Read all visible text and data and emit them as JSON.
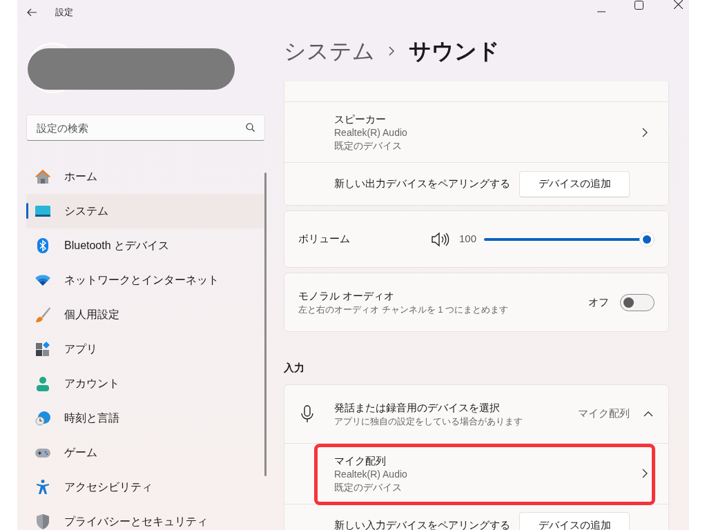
{
  "window": {
    "title": "設定"
  },
  "sidebar": {
    "search": {
      "placeholder": "設定の検索"
    },
    "items": [
      {
        "label": "ホーム",
        "kind": "home",
        "selected": false
      },
      {
        "label": "システム",
        "kind": "system",
        "selected": true
      },
      {
        "label": "Bluetooth とデバイス",
        "kind": "bluetooth",
        "selected": false
      },
      {
        "label": "ネットワークとインターネット",
        "kind": "wifi",
        "selected": false
      },
      {
        "label": "個人用設定",
        "kind": "brush",
        "selected": false
      },
      {
        "label": "アプリ",
        "kind": "apps",
        "selected": false
      },
      {
        "label": "アカウント",
        "kind": "account",
        "selected": false
      },
      {
        "label": "時刻と言語",
        "kind": "time",
        "selected": false
      },
      {
        "label": "ゲーム",
        "kind": "game",
        "selected": false
      },
      {
        "label": "アクセシビリティ",
        "kind": "accessibility",
        "selected": false
      },
      {
        "label": "プライバシーとセキュリティ",
        "kind": "shield",
        "selected": false
      }
    ]
  },
  "breadcrumb": [
    "システム",
    "サウンド"
  ],
  "output": {
    "devices": [
      {
        "name": "スピーカー",
        "driver": "Realtek(R) Audio",
        "status": "既定のデバイス"
      }
    ],
    "pair_label": "新しい出力デバイスをペアリングする",
    "pair_button": "デバイスの追加"
  },
  "volume": {
    "label": "ボリューム",
    "reading": "100",
    "level": 1.0
  },
  "mono_audio": {
    "title": "モノラル オーディオ",
    "description": "左と右のオーディオ チャンネルを 1 つにまとめます",
    "state_label": "オフ",
    "on": false
  },
  "input": {
    "heading": "入力",
    "chooser": {
      "title": "発話または録音用のデバイスを選択",
      "description": "アプリに独自の設定をしている場合があります",
      "value": "マイク配列",
      "expanded": true
    },
    "devices": [
      {
        "name": "マイク配列",
        "driver": "Realtek(R) Audio",
        "status": "既定のデバイス",
        "highlighted": true
      }
    ],
    "pair_label": "新しい入力デバイスをペアリングする",
    "pair_button": "デバイスの追加"
  }
}
